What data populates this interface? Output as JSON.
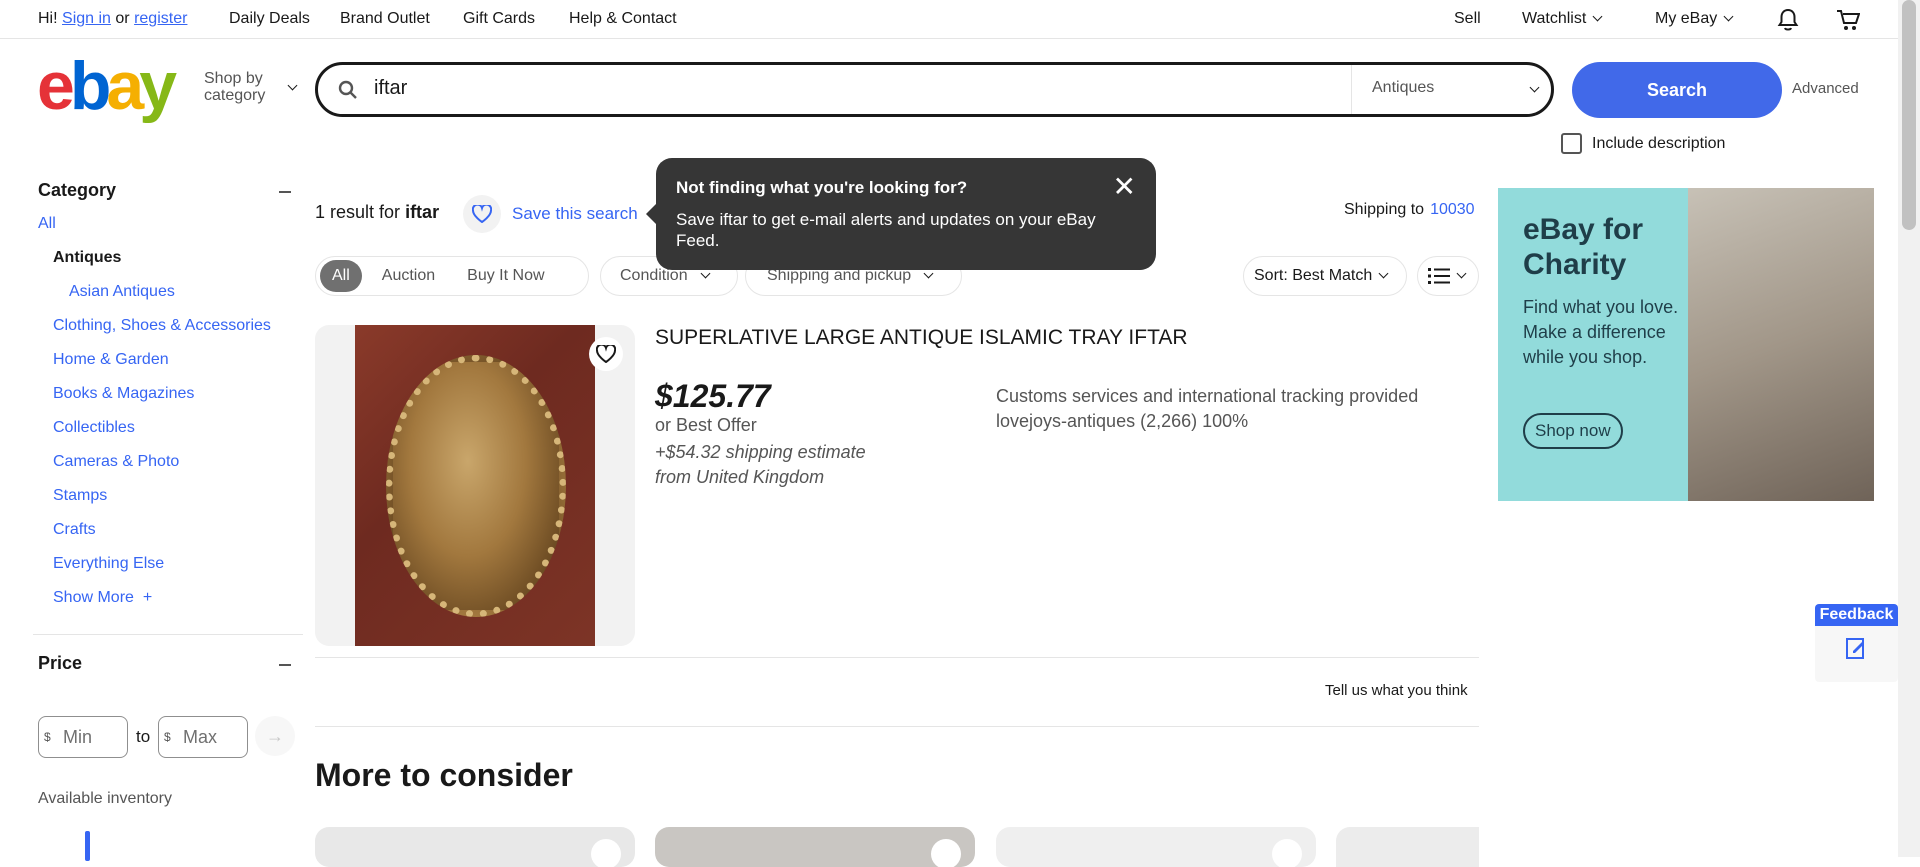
{
  "topbar": {
    "greeting_prefix": "Hi!",
    "signin": "Sign in",
    "or": "or",
    "register": "register",
    "nav": [
      "Daily Deals",
      "Brand Outlet",
      "Gift Cards",
      "Help & Contact"
    ],
    "sell": "Sell",
    "watchlist": "Watchlist",
    "myebay": "My eBay",
    "icons": [
      "notification-bell-icon",
      "cart-icon"
    ]
  },
  "header": {
    "logo_letters": [
      "e",
      "b",
      "a",
      "y"
    ],
    "shop_by": "Shop by",
    "category": "category",
    "search_value": "iftar",
    "search_category": "Antiques",
    "search_button": "Search",
    "advanced": "Advanced",
    "include_description": "Include description"
  },
  "sidebar": {
    "category_title": "Category",
    "categories": [
      "All",
      "Antiques",
      "Asian Antiques",
      "Clothing, Shoes & Accessories",
      "Home & Garden",
      "Books & Magazines",
      "Collectibles",
      "Cameras & Photo",
      "Stamps",
      "Crafts",
      "Everything Else"
    ],
    "show_more": "Show More",
    "show_more_plus": "+",
    "price_title": "Price",
    "price_currency": "$",
    "min_placeholder": "Min",
    "max_placeholder": "Max",
    "to": "to",
    "available_inventory": "Available inventory"
  },
  "results": {
    "count_text": "1 result for",
    "query": "iftar",
    "save_search": "Save this search",
    "shipping_to": "Shipping to",
    "zip": "10030",
    "filters": {
      "buying_format": [
        "All",
        "Auction",
        "Buy It Now"
      ],
      "condition": "Condition",
      "shipping": "Shipping and pickup",
      "sort": "Sort: Best Match"
    }
  },
  "tooltip": {
    "title": "Not finding what you're looking for?",
    "body": "Save iftar to get e-mail alerts and updates on your eBay Feed.",
    "close": "✕"
  },
  "item": {
    "title": "SUPERLATIVE LARGE ANTIQUE ISLAMIC TRAY IFTAR",
    "price": "$125.77",
    "best_offer": "or Best Offer",
    "shipping": "+$54.32 shipping estimate",
    "from": "from United Kingdom",
    "customs": "Customs services and international tracking provided",
    "seller": "lovejoys-antiques (2,266) 100%"
  },
  "feedback_prompt": "Tell us what you think",
  "more_title": "More to consider",
  "ad": {
    "title_line1": "eBay for",
    "title_line2": "Charity",
    "body": "Find what you love. Make a difference while you shop.",
    "button": "Shop now"
  },
  "feedback_tab": "Feedback",
  "colors": {
    "accent": "#3665f3",
    "search_button": "#4169e9",
    "tooltip_bg": "#363636",
    "ad_bg": "#92dbdb"
  }
}
